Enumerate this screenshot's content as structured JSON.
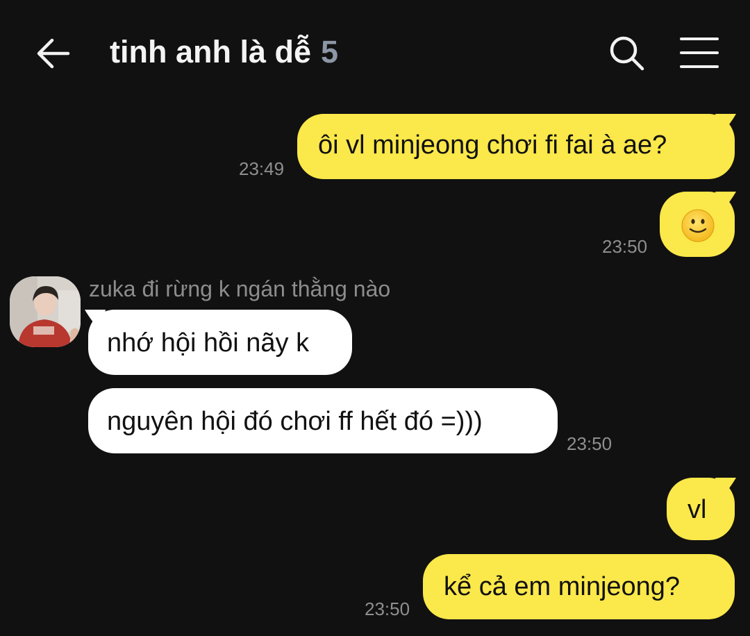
{
  "header": {
    "back_icon": "arrow-left-icon",
    "title": "tinh anh là dễ",
    "member_count": "5",
    "search_icon": "search-icon",
    "menu_icon": "hamburger-menu-icon"
  },
  "colors": {
    "background": "#111111",
    "my_bubble": "#fbe84a",
    "their_bubble": "#ffffff",
    "timestamp": "#8f8f8f"
  },
  "messages": [
    {
      "from": "me",
      "text": "ôi vl minjeong chơi fi fai à ae?",
      "time": "23:49"
    },
    {
      "from": "me",
      "text": "🙂",
      "time": "23:50"
    },
    {
      "from": "them",
      "sender": "zuka đi rừng k ngán thằng nào",
      "text": "nhớ hội hồi nãy k"
    },
    {
      "from": "them",
      "text": "nguyên hội đó chơi ff hết đó =)))",
      "time": "23:50"
    },
    {
      "from": "me",
      "text": "vl"
    },
    {
      "from": "me",
      "text": "kể cả em minjeong?",
      "time": "23:50"
    }
  ]
}
